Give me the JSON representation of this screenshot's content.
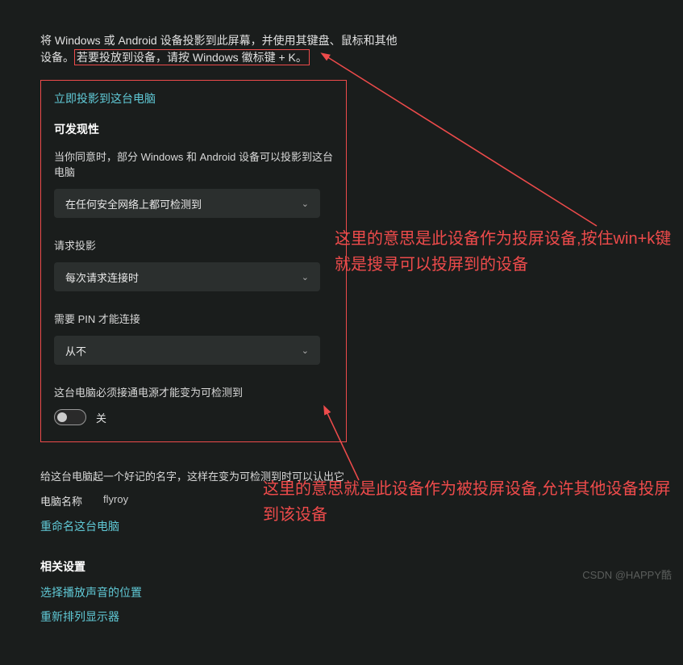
{
  "intro": {
    "line1": "将 Windows 或 Android 设备投影到此屏幕，并使用其键盘、鼠标和其他",
    "line2_prefix": "设备。",
    "line2_highlight": "若要投放到设备，请按 Windows 徽标键 + K。"
  },
  "link_project_now": "立即投影到这台电脑",
  "discoverability": {
    "title": "可发现性",
    "desc": "当你同意时，部分 Windows 和 Android 设备可以投影到这台电脑",
    "dropdown_value": "在任何安全网络上都可检测到"
  },
  "request_projection": {
    "label": "请求投影",
    "dropdown_value": "每次请求连接时"
  },
  "require_pin": {
    "label": "需要 PIN 才能连接",
    "dropdown_value": "从不"
  },
  "power_detection": {
    "desc": "这台电脑必须接通电源才能变为可检测到",
    "toggle_label": "关"
  },
  "naming": {
    "desc": "给这台电脑起一个好记的名字，这样在变为可检测到时可以认出它",
    "label": "电脑名称",
    "value": "flyroy",
    "rename_link": "重命名这台电脑"
  },
  "related": {
    "title": "相关设置",
    "link1": "选择播放声音的位置",
    "link2": "重新排列显示器"
  },
  "annotations": {
    "a1": "这里的意思是此设备作为投屏设备,按住win+k键就是搜寻可以投屏到的设备",
    "a2": "这里的意思就是此设备作为被投屏设备,允许其他设备投屏到该设备"
  },
  "watermark": "CSDN @HAPPY酷"
}
